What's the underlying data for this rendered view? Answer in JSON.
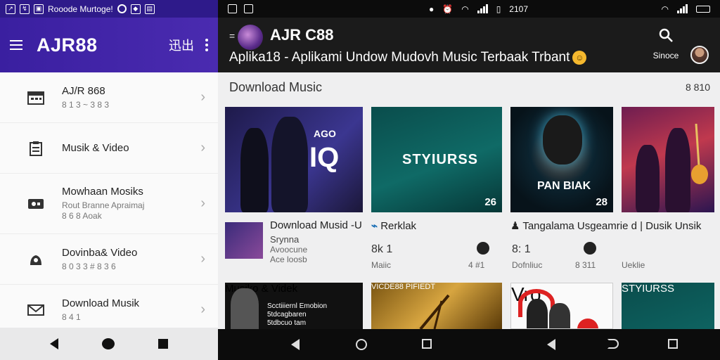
{
  "left": {
    "status_title": "Rooode Murtoge!",
    "app_title": "AJR88",
    "app_badge": "迅出",
    "menu": [
      {
        "icon": "calendar-icon",
        "title": "AJ/R 868",
        "sub": "8 1 3 ~ 3 8 3"
      },
      {
        "icon": "clipboard-icon",
        "title": "Musik & Video",
        "sub": ""
      },
      {
        "icon": "video-icon",
        "title": "Mowhaan Mosiks",
        "sub": "Rout Branne Apraimaj\n8 6 8 Aoak"
      },
      {
        "icon": "user-icon",
        "title": "Dovinba& Video",
        "sub": "8 0 3 3 # 8 3 6"
      },
      {
        "icon": "mail-icon",
        "title": "Download Musik",
        "sub": "8 4 1"
      }
    ]
  },
  "right": {
    "status_time": "2107",
    "app_title": "AJR C88",
    "app_subtitle": "Aplika18 - Aplikami Undow Mudovh Music Terbaak Trbant",
    "search_label": "Sinoce",
    "section_title": "Download Music",
    "section_count": "8 810",
    "cards": [
      {
        "name": "album-card-1",
        "text": "IQ",
        "corner": "AGO"
      },
      {
        "name": "album-card-2",
        "text": "STYIURSS",
        "number": "26"
      },
      {
        "name": "album-card-3",
        "text": "PAN BIAK",
        "number": "28"
      },
      {
        "name": "album-card-4",
        "text": "",
        "number": ""
      }
    ],
    "info": [
      {
        "title": "Download Musid -U",
        "sub": "Srynna",
        "meta1": "Avoocune",
        "meta2": "Ace loosb",
        "stat": "8k 1",
        "small": "Maiic",
        "right_small": "4 #1"
      },
      {
        "title": "Rerklak",
        "stat": "8: 1",
        "small": "Dofnliuc",
        "right_small": "8 311"
      },
      {
        "title": "Tangalama Usgeamrie d | Dusik Unsik",
        "small": "Ueklie"
      }
    ],
    "row2": [
      {
        "name": "album-card-5",
        "text": "Musiko & Videk",
        "sub": "Scctiiiernl Emobion\n5tdcagbaren\n5tdbcuo tam"
      },
      {
        "name": "album-card-6",
        "text": "VICDE88 PIFIEDT"
      },
      {
        "name": "album-card-7",
        "text": "Vro"
      },
      {
        "name": "album-card-8",
        "text": "STYIURSS"
      }
    ]
  }
}
